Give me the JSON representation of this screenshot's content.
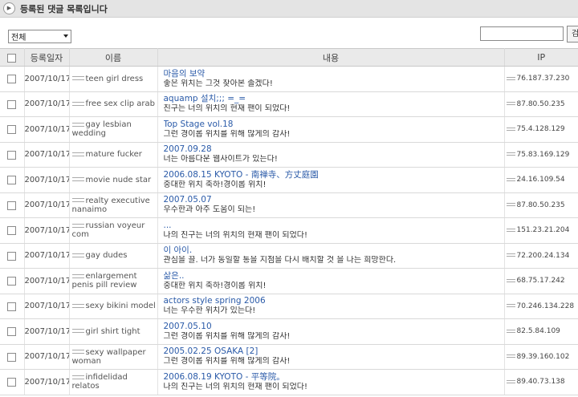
{
  "header": {
    "title": "등록된 댓글 목록입니다"
  },
  "filter": {
    "selected": "전체"
  },
  "search": {
    "value": "",
    "button_label": "검"
  },
  "columns": {
    "date": "등록일자",
    "name": "이름",
    "content": "내용",
    "ip": "IP"
  },
  "rows": [
    {
      "date": "2007/10/17",
      "name": "teen girl dress",
      "subject": "마음의 보약",
      "body": "좋은 위치는 그것 찾아본 졸겠다!",
      "ip": "76.187.37.230"
    },
    {
      "date": "2007/10/17",
      "name": "free sex clip arab",
      "subject": "aquamp 설치;;; =_=",
      "body": "친구는 너의 위치의 현재 팬이 되었다!",
      "ip": "87.80.50.235"
    },
    {
      "date": "2007/10/17",
      "name": "gay lesbian wedding",
      "subject": "Top Stage vol.18",
      "body": "그런 경이롭 위치를 위해 많게의 감사!",
      "ip": "75.4.128.129"
    },
    {
      "date": "2007/10/17",
      "name": "mature fucker",
      "subject": "2007.09.28",
      "body": "너는 아름다운 웹사이트가 있는다!",
      "ip": "75.83.169.129"
    },
    {
      "date": "2007/10/17",
      "name": "movie nude star",
      "subject": "2006.08.15 KYOTO - 南禅寺、方丈庭園",
      "body": "중대한 위치 축하!경이롭 위치!",
      "ip": "24.16.109.54"
    },
    {
      "date": "2007/10/17",
      "name": "realty executive nanaimo",
      "subject": "2007.05.07",
      "body": "우수한과 아주 도움이 되는!",
      "ip": "87.80.50.235"
    },
    {
      "date": "2007/10/17",
      "name": "russian voyeur com",
      "subject": "...",
      "body": "나의 친구는 너의 위치의 현재 팬이 되었다!",
      "ip": "151.23.21.204"
    },
    {
      "date": "2007/10/17",
      "name": "gay dudes",
      "subject": "이 아이.",
      "body": "관심을 끌. 너가 동일할 통을 지점을 다시 배치할 것 을 나는 희망한다.",
      "ip": "72.200.24.134"
    },
    {
      "date": "2007/10/17",
      "name": "enlargement penis pill review",
      "subject": "삶은..",
      "body": "중대한 위치 축하!경이롭 위치!",
      "ip": "68.75.17.242"
    },
    {
      "date": "2007/10/17",
      "name": "sexy bikini model",
      "subject": "actors style spring 2006",
      "body": "너는 우수한 위치가 있는다!",
      "ip": "70.246.134.228"
    },
    {
      "date": "2007/10/17",
      "name": "girl shirt tight",
      "subject": "2007.05.10",
      "body": "그런 경이롭 위치를 위해 많게의 감사!",
      "ip": "82.5.84.109"
    },
    {
      "date": "2007/10/17",
      "name": "sexy wallpaper woman",
      "subject": "2005.02.25 OSAKA [2]",
      "body": "그런 경이롭 위치를 위해 많게의 감사!",
      "ip": "89.39.160.102"
    },
    {
      "date": "2007/10/17",
      "name": "infidelidad relatos",
      "subject": "2006.08.19 KYOTO - 平等院。",
      "body": "나의 친구는 너의 위치의 현재 팬이 되었다!",
      "ip": "89.40.73.138"
    }
  ]
}
